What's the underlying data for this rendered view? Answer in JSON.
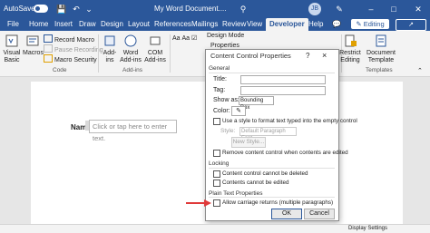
{
  "titlebar": {
    "autosave": "AutoSave",
    "toggle_state": "On",
    "doc_title": "My Word Document....",
    "avatar_initials": "JB"
  },
  "tabs": [
    "File",
    "Home",
    "Insert",
    "Draw",
    "Design",
    "Layout",
    "References",
    "Mailings",
    "Review",
    "View",
    "Developer",
    "Help"
  ],
  "active_tab": "Developer",
  "editing_label": "Editing",
  "ribbon": {
    "visual_basic": "Visual Basic",
    "macros": "Macros",
    "record_macro": "Record Macro",
    "pause_recording": "Pause Recording",
    "macro_security": "Macro Security",
    "code_group": "Code",
    "add_ins": "Add-ins",
    "word_add_ins": "Word Add-ins",
    "com_add_ins": "COM Add-ins",
    "add_ins_group": "Add-ins",
    "design_mode": "Design Mode",
    "properties": "Properties",
    "restrict_editing": "Restrict Editing",
    "document_template": "Document Template",
    "templates_group": "Templates"
  },
  "document": {
    "name_label": "Name:",
    "placeholder": "Click or tap here to enter text."
  },
  "dialog": {
    "title": "Content Control Properties",
    "help": "?",
    "close": "×",
    "general": "General",
    "title_label": "Title:",
    "tag_label": "Tag:",
    "show_as_label": "Show as:",
    "show_as_value": "Bounding Box",
    "color_label": "Color:",
    "use_style": "Use a style to format text typed into the empty control",
    "style_label": "Style:",
    "style_value": "Default Paragraph Font",
    "new_style": "New Style...",
    "remove_cc": "Remove content control when contents are edited",
    "locking": "Locking",
    "lock_delete": "Content control cannot be deleted",
    "lock_edit": "Contents cannot be edited",
    "plain_text": "Plain Text Properties",
    "allow_returns": "Allow carriage returns (multiple paragraphs)",
    "ok": "OK",
    "cancel": "Cancel"
  },
  "statusbar": {
    "display_settings": "Display Settings"
  },
  "colors": {
    "brand_blue": "#2b579a",
    "arrow_red": "#e03a3a"
  }
}
